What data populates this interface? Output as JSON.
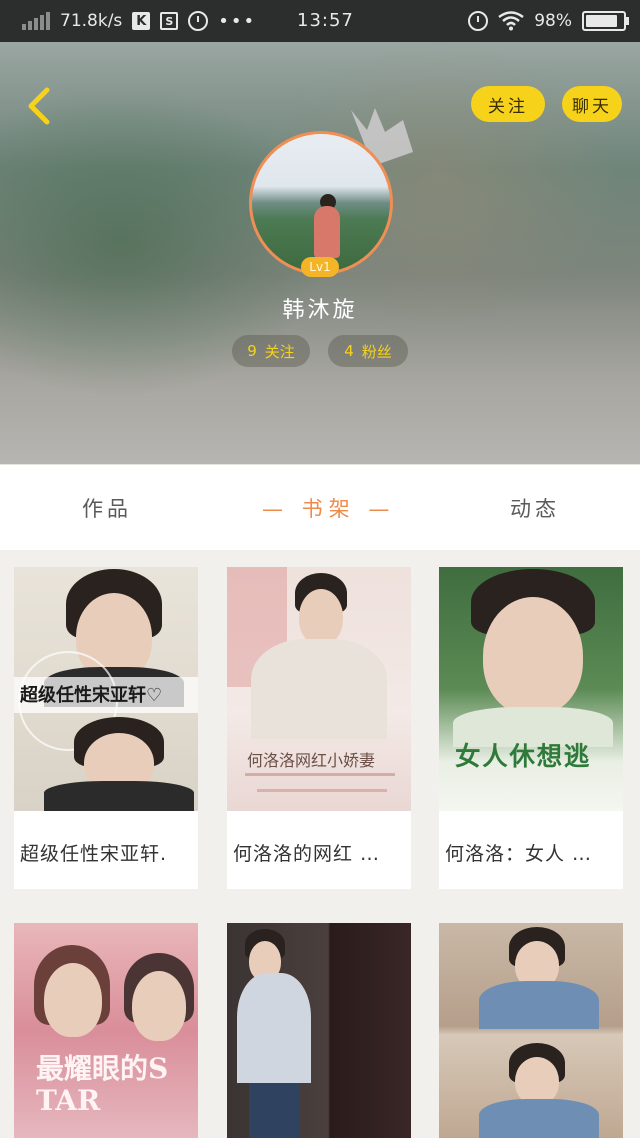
{
  "status_bar": {
    "net_speed": "71.8k/s",
    "badge_k": "K",
    "badge_s": "S",
    "dots": "•••",
    "time": "13:57",
    "battery": "98%",
    "battery_level": 0.98
  },
  "header": {
    "follow_label": "关注",
    "chat_label": "聊天",
    "level": "Lv1",
    "username": "韩沐旋",
    "following_count": "9",
    "following_label": "关注",
    "fans_count": "4",
    "fans_label": "粉丝"
  },
  "tabs": {
    "works": "作品",
    "bookshelf": "— 书架 —",
    "moments": "动态"
  },
  "books": [
    {
      "title": "超级任性宋亚轩.",
      "cover_text": "超级任性宋亚轩♡"
    },
    {
      "title": "何洛洛的网红 …",
      "cover_text": "何洛洛网红小娇妻"
    },
    {
      "title": "何洛洛：女人 …",
      "cover_text": "女人休想逃"
    },
    {
      "title": "",
      "cover_text": "最耀眼的STAR"
    },
    {
      "title": "",
      "cover_text": ""
    },
    {
      "title": "",
      "cover_text": ""
    }
  ],
  "colors": {
    "accent_yellow": "#f6d21a",
    "tab_active": "#f08a4a",
    "avatar_ring": "#f08f55"
  }
}
